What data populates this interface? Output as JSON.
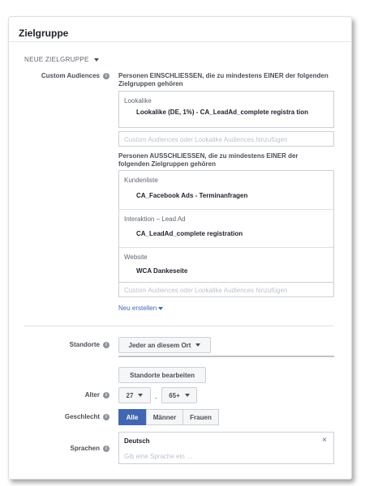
{
  "header": {
    "title": "Zielgruppe"
  },
  "subhead": "NEUE ZIELGRUPPE",
  "custom_audiences": {
    "label": "Custom Audiences",
    "include_desc": "Personen EINSCHLIESSEN, die zu mindestens EINER der folgenden Zielgruppen gehören",
    "include_sections": [
      {
        "title": "Lookalike",
        "item": "Lookalike (DE, 1%) - CA_LeadAd_complete registra tion"
      }
    ],
    "include_placeholder": "Custom Audiences oder Lookalike Audiences hinzufügen",
    "exclude_desc": "Personen AUSSCHLIESSEN, die zu mindestens EINER der folgenden Zielgruppen gehören",
    "exclude_sections": [
      {
        "title": "Kundenliste",
        "item": "CA_Facebook Ads - Terminanfragen"
      },
      {
        "title": "Interaktion – Lead Ad",
        "item": "CA_LeadAd_complete registration"
      },
      {
        "title": "Website",
        "item": "WCA Dankeseite"
      }
    ],
    "exclude_placeholder": "Custom Audiences oder Lookalike Audiences hinzufügen",
    "create_link": "Neu erstellen"
  },
  "standorte": {
    "label": "Standorte",
    "dropdown": "Jeder an diesem Ort",
    "edit_button": "Standorte bearbeiten"
  },
  "alter": {
    "label": "Alter",
    "min": "27",
    "dash": "-",
    "max": "65+"
  },
  "geschlecht": {
    "label": "Geschlecht",
    "options": [
      "Alle",
      "Männer",
      "Frauen"
    ],
    "selected": "Alle"
  },
  "sprachen": {
    "label": "Sprachen",
    "selected": "Deutsch",
    "remove": "×",
    "placeholder": "Gib eine Sprache ein ..."
  },
  "info_glyph": "i"
}
